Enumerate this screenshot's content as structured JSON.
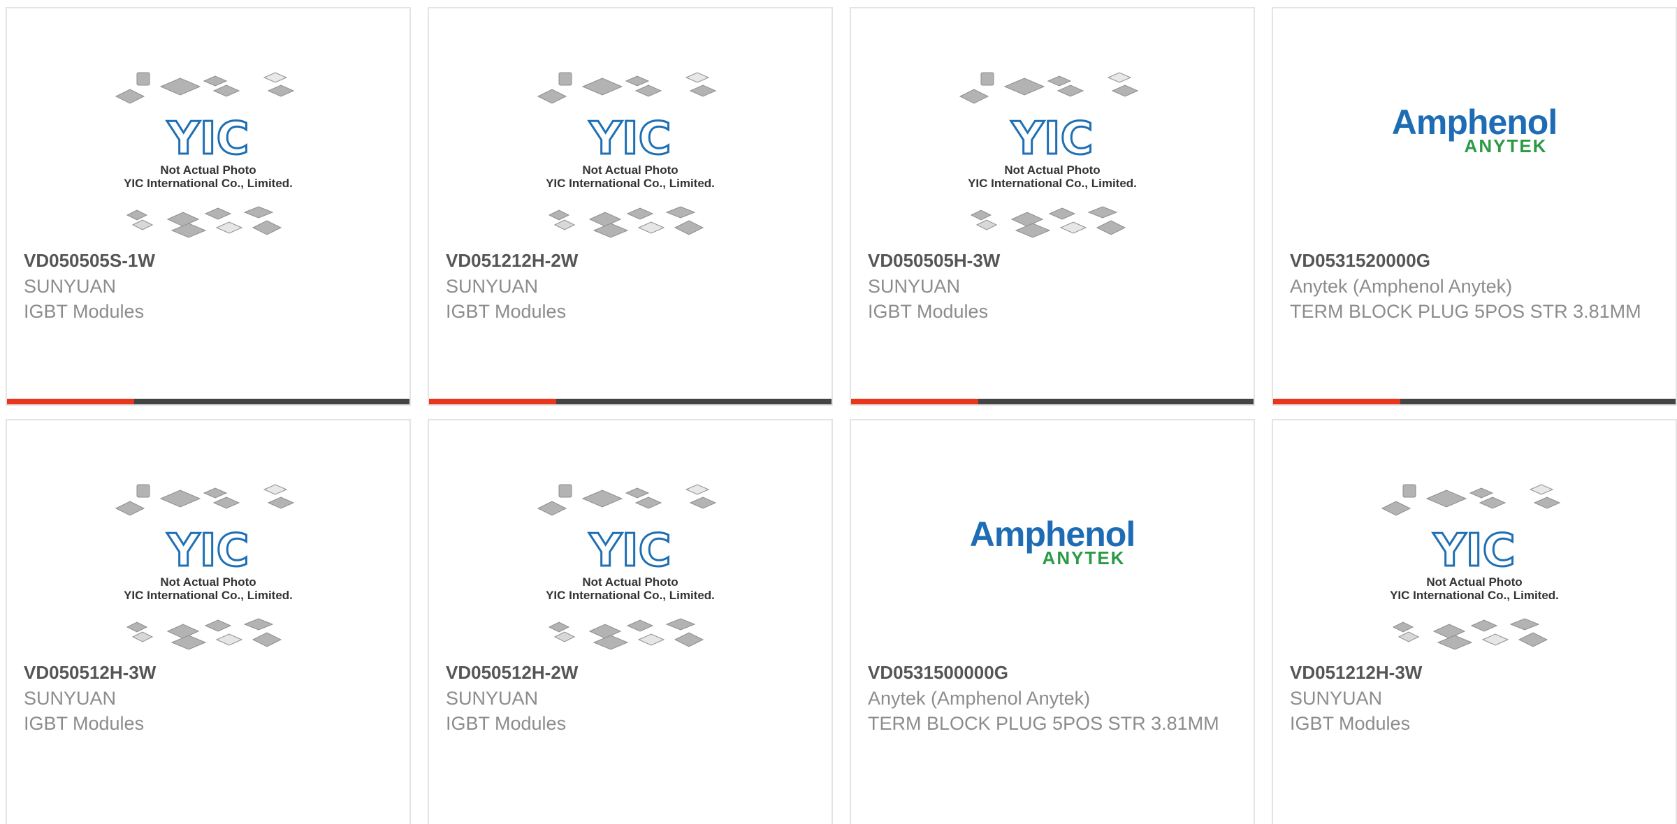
{
  "placeholder_image": {
    "line1": "Not Actual Photo",
    "line2": "YIC International Co., Limited.",
    "logo_text": "YIC"
  },
  "brand_logo": {
    "name": "Amphenol",
    "sub": "ANYTEK"
  },
  "products": [
    {
      "part": "VD050505S-1W",
      "manufacturer": "SUNYUAN",
      "description": "IGBT Modules",
      "image": "yic-placeholder"
    },
    {
      "part": "VD051212H-2W",
      "manufacturer": "SUNYUAN",
      "description": "IGBT Modules",
      "image": "yic-placeholder"
    },
    {
      "part": "VD050505H-3W",
      "manufacturer": "SUNYUAN",
      "description": "IGBT Modules",
      "image": "yic-placeholder"
    },
    {
      "part": "VD0531520000G",
      "manufacturer": "Anytek (Amphenol Anytek)",
      "description": "TERM BLOCK PLUG 5POS STR 3.81MM",
      "image": "amphenol-anytek-logo"
    },
    {
      "part": "VD050512H-3W",
      "manufacturer": "SUNYUAN",
      "description": "IGBT Modules",
      "image": "yic-placeholder"
    },
    {
      "part": "VD050512H-2W",
      "manufacturer": "SUNYUAN",
      "description": "IGBT Modules",
      "image": "yic-placeholder"
    },
    {
      "part": "VD0531500000G",
      "manufacturer": "Anytek (Amphenol Anytek)",
      "description": "TERM BLOCK PLUG 5POS STR 3.81MM",
      "image": "amphenol-anytek-logo"
    },
    {
      "part": "VD051212H-3W",
      "manufacturer": "SUNYUAN",
      "description": "IGBT Modules",
      "image": "yic-placeholder"
    }
  ],
  "colors": {
    "accent_bar": "#e8361c",
    "bar_dark": "#444444",
    "part_text": "#555555",
    "meta_text": "#8c8c8c",
    "yic_blue": "#1e6fb4",
    "amphenol_blue": "#1d6cb4",
    "anytek_green": "#2a9a47"
  }
}
